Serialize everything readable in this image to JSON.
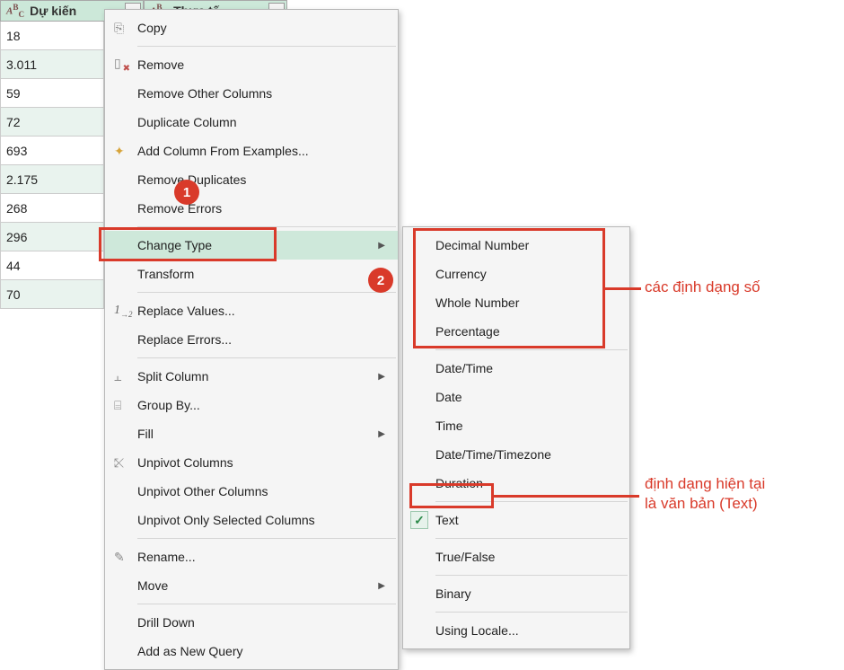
{
  "columns": [
    {
      "type_prefix": "ABC",
      "name": "Dự kiến"
    },
    {
      "type_prefix": "ABC",
      "name": "Thực tế"
    }
  ],
  "cells": [
    "18",
    "3.011",
    "59",
    "72",
    "693",
    "2.175",
    "268",
    "296",
    "44",
    "70"
  ],
  "context_menu": {
    "copy": "Copy",
    "remove": "Remove",
    "remove_other": "Remove Other Columns",
    "duplicate": "Duplicate Column",
    "add_from_examples": "Add Column From Examples...",
    "remove_dup": "Remove Duplicates",
    "remove_err": "Remove Errors",
    "change_type": "Change Type",
    "transform": "Transform",
    "replace_values": "Replace Values...",
    "replace_errors": "Replace Errors...",
    "split": "Split Column",
    "group_by": "Group By...",
    "fill": "Fill",
    "unpivot": "Unpivot Columns",
    "unpivot_other": "Unpivot Other Columns",
    "unpivot_sel": "Unpivot Only Selected Columns",
    "rename": "Rename...",
    "move": "Move",
    "drill": "Drill Down",
    "add_query": "Add as New Query"
  },
  "submenu": {
    "decimal": "Decimal Number",
    "currency": "Currency",
    "whole": "Whole Number",
    "percentage": "Percentage",
    "datetime": "Date/Time",
    "date": "Date",
    "time": "Time",
    "dtz": "Date/Time/Timezone",
    "duration": "Duration",
    "text": "Text",
    "truefalse": "True/False",
    "binary": "Binary",
    "locale": "Using Locale..."
  },
  "annotations": {
    "badge1": "1",
    "badge2": "2",
    "number_formats": "các định dạng số",
    "current_format_l1": "định dạng hiện tại",
    "current_format_l2": "là văn bản (Text)"
  }
}
